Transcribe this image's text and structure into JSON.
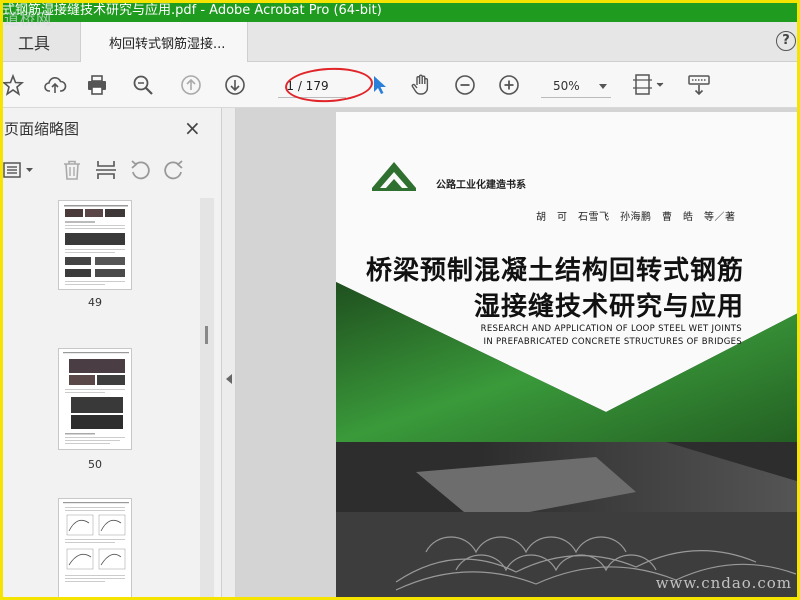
{
  "window": {
    "title": "式钢筋湿接缝技术研究与应用.pdf - Adobe Acrobat Pro (64-bit)"
  },
  "watermark": {
    "top_left": "道桥网",
    "bottom_right": "www.cndao.com"
  },
  "tabs": {
    "tools_label": "工具",
    "document_label": "构回转式钢筋湿接...",
    "help_label": "?"
  },
  "toolbar": {
    "current_page": "1",
    "total_pages": "/ 179",
    "zoom_value": "50%"
  },
  "sidebar": {
    "title": "页面缩略图",
    "close_label": "×",
    "thumbnails": [
      {
        "page_number": "49"
      },
      {
        "page_number": "50"
      }
    ]
  },
  "book": {
    "series": "公路工业化建造书系",
    "authors": "胡　可　石雪飞　孙海鹏　曹　皓　等／著",
    "title_line1": "桥梁预制混凝土结构回转式钢筋",
    "title_line2": "湿接缝技术研究与应用",
    "title_en_line1": "RESEARCH AND APPLICATION OF LOOP STEEL WET JOINTS",
    "title_en_line2": "IN PREFABRICATED CONCRETE STRUCTURES OF BRIDGES"
  },
  "colors": {
    "titlebar": "#1f9b1f",
    "frame": "#f5e400",
    "annotation_oval": "#e0262a",
    "cover_green": "#2e8f2e",
    "cursor": "#2a7fd9"
  },
  "icons": [
    "star-icon",
    "upload-icon",
    "print-icon",
    "zoom-search-icon",
    "prev-page-icon",
    "next-page-icon",
    "cursor-arrow-icon",
    "hand-tool-icon",
    "zoom-out-icon",
    "zoom-in-icon",
    "fit-page-icon",
    "keyboard-tool-icon",
    "options-icon",
    "trash-icon",
    "insert-page-icon",
    "undo-icon",
    "redo-icon"
  ]
}
